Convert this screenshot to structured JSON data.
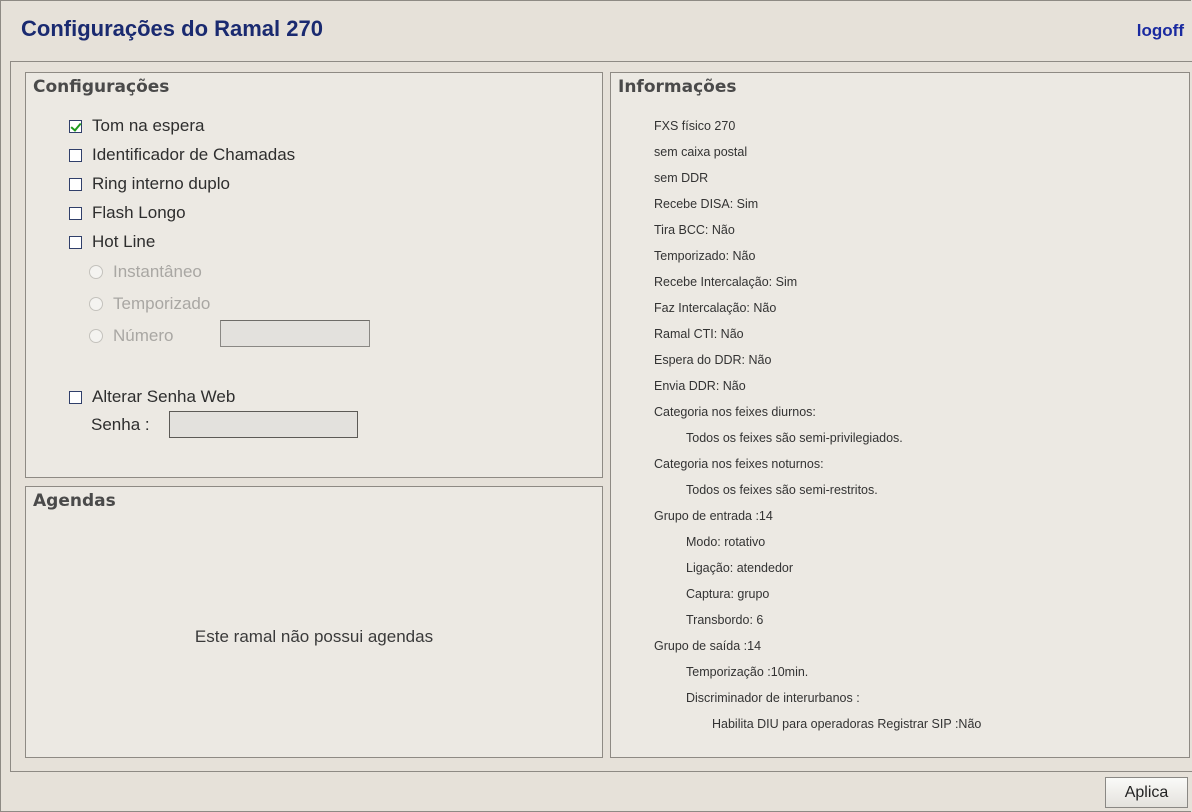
{
  "header": {
    "title": "Configurações do Ramal 270",
    "logoff": "logoff"
  },
  "config": {
    "title": "Configurações",
    "options": [
      {
        "label": "Tom na espera",
        "checked": true
      },
      {
        "label": "Identificador de Chamadas",
        "checked": false
      },
      {
        "label": "Ring interno duplo",
        "checked": false
      },
      {
        "label": "Flash Longo",
        "checked": false
      },
      {
        "label": "Hot Line",
        "checked": false
      }
    ],
    "hotline_modes": [
      "Instantâneo",
      "Temporizado",
      "Número"
    ],
    "numero_value": "",
    "alterar_senha": {
      "label": "Alterar Senha Web",
      "checked": false
    },
    "senha_label": "Senha :",
    "senha_value": ""
  },
  "agendas": {
    "title": "Agendas",
    "empty_text": "Este ramal não possui agendas"
  },
  "info": {
    "title": "Informações",
    "lines": [
      "FXS físico 270",
      "sem caixa postal",
      "sem DDR",
      "Recebe DISA: Sim",
      "Tira BCC: Não",
      "Temporizado: Não",
      "Recebe Intercalação: Sim",
      "Faz Intercalação: Não",
      "Ramal CTI: Não",
      "Espera do DDR: Não",
      "Envia DDR: Não",
      "Categoria nos feixes diurnos:",
      "Todos os feixes são semi-privilegiados.",
      "Categoria nos feixes noturnos:",
      "Todos os feixes são semi-restritos.",
      "Grupo de entrada :14",
      "Modo: rotativo",
      "Ligação: atendedor",
      "Captura: grupo",
      "Transbordo:  6",
      "Grupo de saída :14",
      "Temporização :10min.",
      "Discriminador de interurbanos :",
      "Habilita DIU para operadoras Registrar SIP :Não"
    ]
  },
  "footer": {
    "apply_label": "Aplica"
  }
}
